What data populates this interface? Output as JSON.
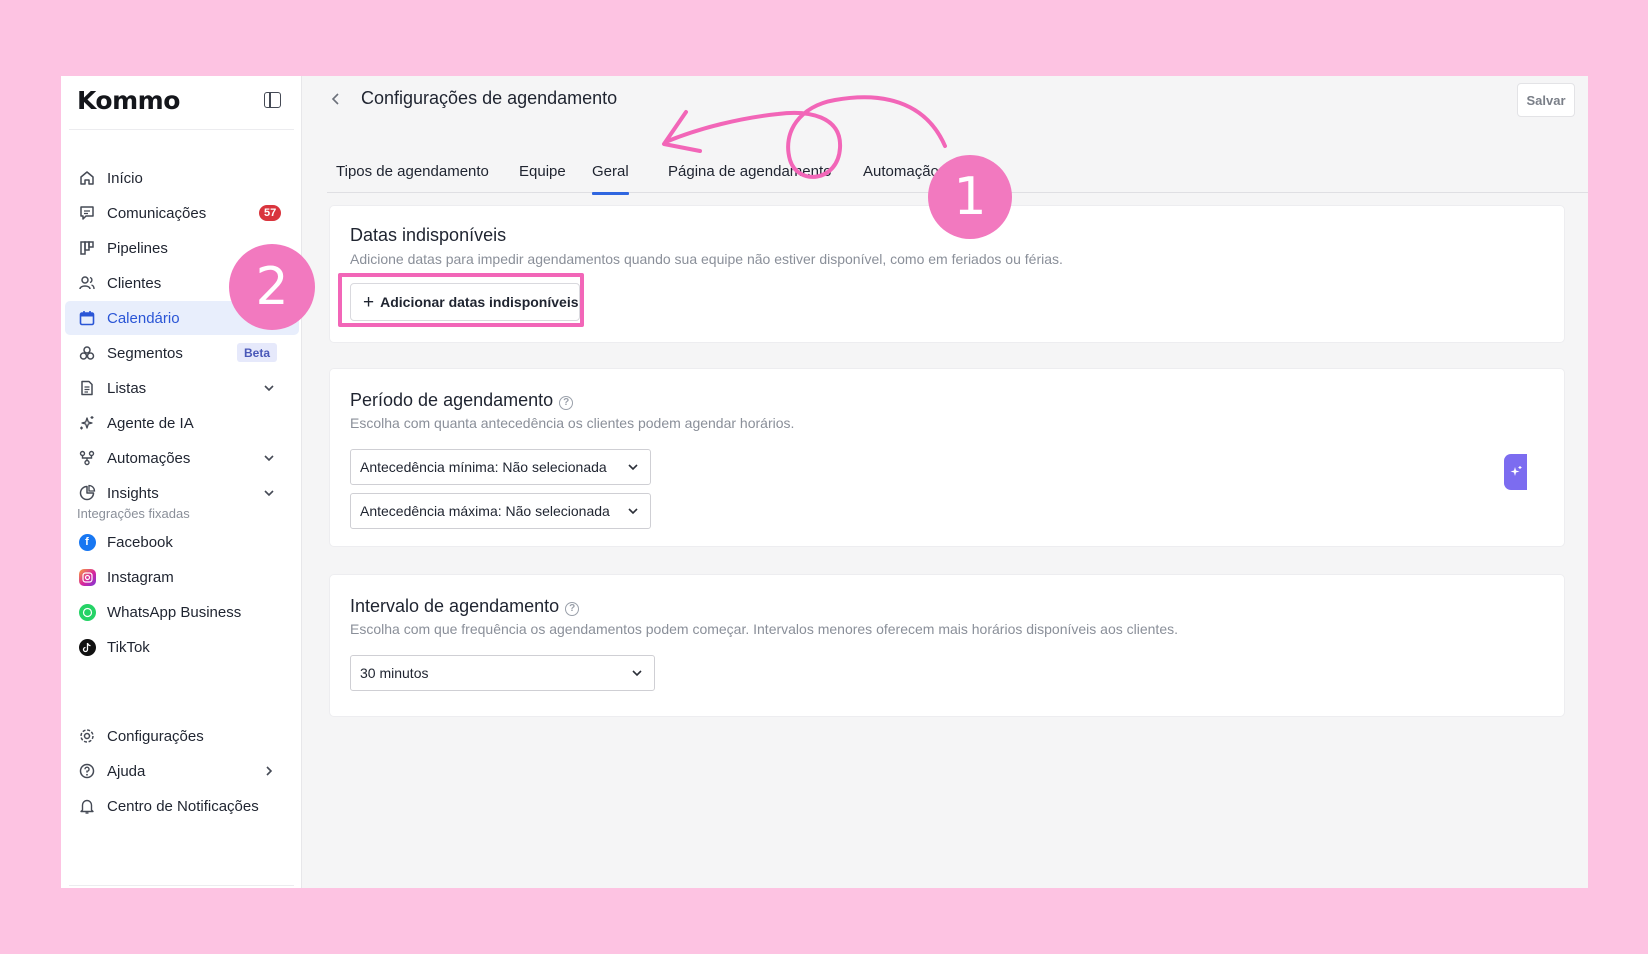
{
  "brand": {
    "logo_text": "Kommo"
  },
  "sidebar": {
    "items": [
      {
        "label": "Início",
        "icon": "home-icon"
      },
      {
        "label": "Comunicações",
        "icon": "chat-icon",
        "badge": "57"
      },
      {
        "label": "Pipelines",
        "icon": "pipeline-icon",
        "chevron": "down"
      },
      {
        "label": "Clientes",
        "icon": "users-icon"
      },
      {
        "label": "Calendário",
        "icon": "calendar-icon",
        "active": true
      },
      {
        "label": "Segmentos",
        "icon": "segments-icon",
        "tag": "Beta"
      },
      {
        "label": "Listas",
        "icon": "list-icon",
        "chevron": "down"
      },
      {
        "label": "Agente de IA",
        "icon": "sparkle-icon"
      },
      {
        "label": "Automações",
        "icon": "automation-icon",
        "chevron": "down"
      },
      {
        "label": "Insights",
        "icon": "pie-chart-icon",
        "chevron": "down"
      }
    ],
    "pinned_section_label": "Integrações fixadas",
    "pinned": [
      {
        "label": "Facebook",
        "icon": "facebook-icon",
        "color": "#1877f2"
      },
      {
        "label": "Instagram",
        "icon": "instagram-icon",
        "color": "#d6249f"
      },
      {
        "label": "WhatsApp Business",
        "icon": "whatsapp-icon",
        "color": "#25d366"
      },
      {
        "label": "TikTok",
        "icon": "tiktok-icon",
        "color": "#111111"
      }
    ],
    "bottom": [
      {
        "label": "Configurações",
        "icon": "gear-icon"
      },
      {
        "label": "Ajuda",
        "icon": "help-icon",
        "chevron": "right"
      },
      {
        "label": "Centro de Notificações",
        "icon": "bell-icon"
      }
    ]
  },
  "header": {
    "title": "Configurações de agendamento",
    "save_label": "Salvar"
  },
  "tabs": [
    {
      "label": "Tipos de agendamento"
    },
    {
      "label": "Equipe"
    },
    {
      "label": "Geral",
      "active": true
    },
    {
      "label": "Página de agendamento"
    },
    {
      "label": "Automação"
    }
  ],
  "unavailable": {
    "title": "Datas indisponíveis",
    "description": "Adicione datas para impedir agendamentos quando sua equipe não estiver disponível, como em feriados ou férias.",
    "button_label": "Adicionar datas indisponíveis"
  },
  "period": {
    "title": "Período de agendamento",
    "description": "Escolha com quanta antecedência os clientes podem agendar horários.",
    "min_select": "Antecedência mínima: Não selecionada",
    "max_select": "Antecedência máxima: Não selecionada"
  },
  "interval": {
    "title": "Intervalo de agendamento",
    "description": "Escolha com que frequência os agendamentos podem começar. Intervalos menores oferecem mais horários disponíveis aos clientes.",
    "select_value": "30 minutos"
  },
  "annotations": {
    "step1": "1",
    "step2": "2"
  },
  "colors": {
    "accent": "#2f66e0",
    "highlight": "#f266b8",
    "annotation": "#f279bf",
    "background": "#fdc3e2",
    "badge": "#d9343d"
  }
}
